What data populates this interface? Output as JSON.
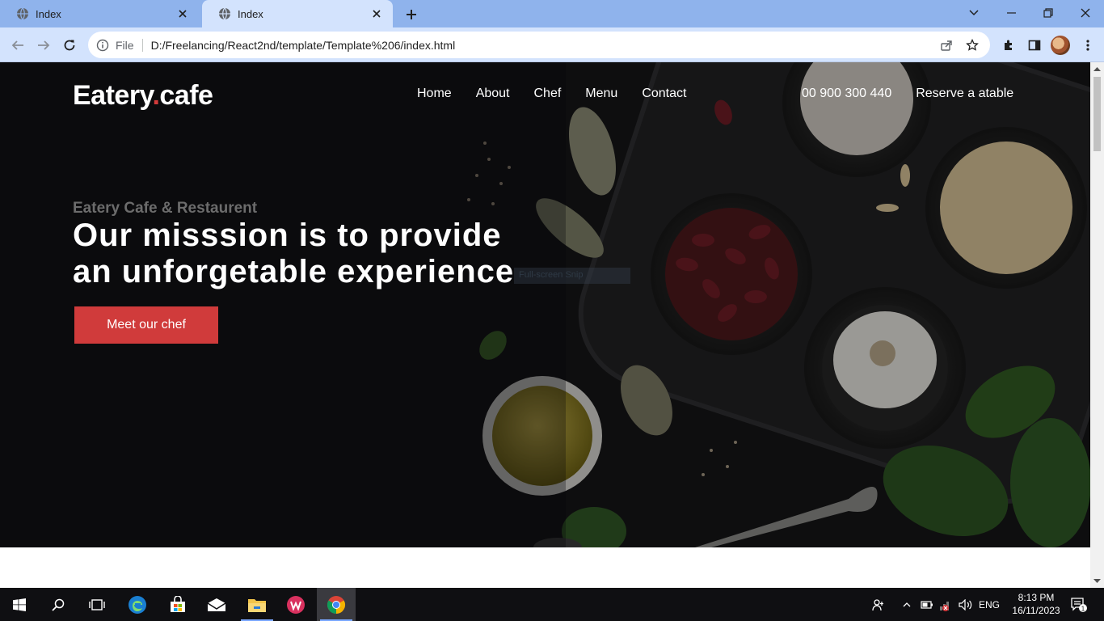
{
  "browser": {
    "tabs": [
      {
        "title": "Index",
        "icon": "globe-icon",
        "active": false
      },
      {
        "title": "Index",
        "icon": "globe-icon",
        "active": true
      }
    ],
    "address_bar": {
      "scheme_label": "File",
      "url": "D:/Freelancing/React2nd/template/Template%206/index.html"
    }
  },
  "page": {
    "logo": {
      "part1": "Eatery",
      "dot": ".",
      "part2": "cafe"
    },
    "nav": [
      "Home",
      "About",
      "Chef",
      "Menu",
      "Contact"
    ],
    "phone": "00 900 300 440",
    "reserve": "Reserve a atable",
    "eyebrow": "Eatery Cafe & Restaurent",
    "headline_line1": "Our misssion is to provide",
    "headline_line2": "an unforgetable experience",
    "cta": "Meet our chef",
    "overlay_hint": "Full-screen Snip",
    "accent_color": "#d03b3b"
  },
  "taskbar": {
    "items": [
      "windows-start-icon",
      "search-icon",
      "task-view-icon",
      "edge-icon",
      "store-icon",
      "mail-icon",
      "file-explorer-icon",
      "app-icon",
      "chrome-icon"
    ],
    "tray": {
      "language": "ENG",
      "notification_count": "1"
    },
    "clock": {
      "time": "8:13 PM",
      "date": "16/11/2023"
    }
  }
}
